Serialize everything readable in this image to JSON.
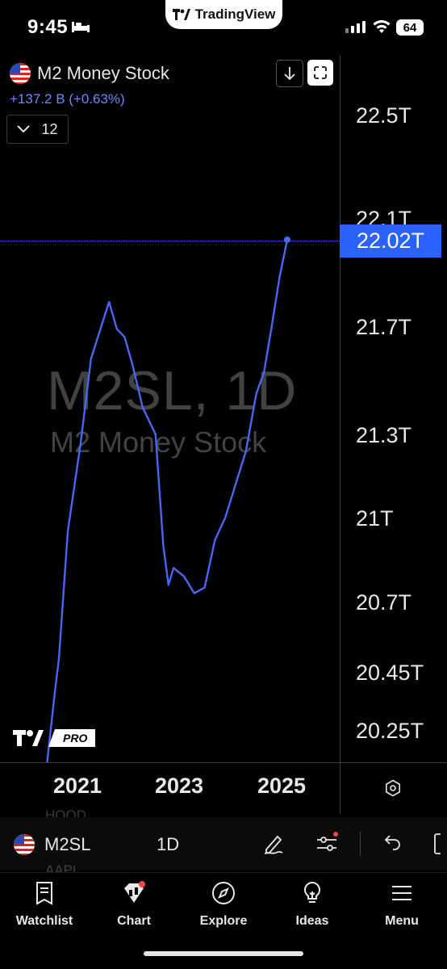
{
  "status_bar": {
    "time": "9:45",
    "app_pill": "TradingView",
    "battery": "64"
  },
  "header": {
    "title": "M2 Money Stock",
    "change": "+137.2 B (+0.63%)",
    "interval_count": "12"
  },
  "watermark": {
    "line1": "M2SL, 1D",
    "line2": "M2 Money Stock"
  },
  "price_axis": {
    "labels": [
      "22.5T",
      "22.1T",
      "21.7T",
      "21.3T",
      "21T",
      "20.7T",
      "20.45T",
      "20.25T"
    ],
    "current": "22.02T"
  },
  "time_axis": {
    "labels": [
      "2021",
      "2023",
      "2025"
    ]
  },
  "logo": {
    "badge": "PRO"
  },
  "ghost_watchlist": [
    "HOOD",
    "AAPL"
  ],
  "ticker_row": {
    "symbol": "M2SL",
    "interval": "1D"
  },
  "nav": [
    {
      "label": "Watchlist",
      "icon": "watchlist-icon"
    },
    {
      "label": "Chart",
      "icon": "chart-icon"
    },
    {
      "label": "Explore",
      "icon": "compass-icon"
    },
    {
      "label": "Ideas",
      "icon": "lightbulb-icon"
    },
    {
      "label": "Menu",
      "icon": "hamburger-icon"
    }
  ],
  "colors": {
    "accent": "#2962ff",
    "line": "#4a66f5",
    "background": "#000000"
  },
  "chart_data": {
    "type": "line",
    "title": "M2 Money Stock",
    "series": [
      {
        "name": "M2SL",
        "points": [
          [
            2020.35,
            19.0
          ],
          [
            2020.5,
            20.38
          ],
          [
            2020.58,
            20.5
          ],
          [
            2020.75,
            20.95
          ],
          [
            2021.0,
            21.27
          ],
          [
            2021.2,
            21.58
          ],
          [
            2021.45,
            21.73
          ],
          [
            2021.55,
            21.79
          ],
          [
            2021.7,
            21.69
          ],
          [
            2021.85,
            21.66
          ],
          [
            2022.0,
            21.56
          ],
          [
            2022.2,
            21.4
          ],
          [
            2022.45,
            21.3
          ],
          [
            2022.6,
            20.9
          ],
          [
            2022.7,
            20.76
          ],
          [
            2022.8,
            20.82
          ],
          [
            2023.0,
            20.79
          ],
          [
            2023.2,
            20.73
          ],
          [
            2023.4,
            20.75
          ],
          [
            2023.6,
            20.92
          ],
          [
            2023.8,
            21.0
          ],
          [
            2024.0,
            21.12
          ],
          [
            2024.2,
            21.24
          ],
          [
            2024.4,
            21.45
          ],
          [
            2024.55,
            21.53
          ],
          [
            2024.7,
            21.7
          ],
          [
            2024.85,
            21.88
          ],
          [
            2025.0,
            22.02
          ]
        ]
      }
    ],
    "ylabel": "",
    "xlabel": "",
    "last_value": 22.02,
    "yticks": [
      22.5,
      22.1,
      21.7,
      21.3,
      21.0,
      20.7,
      20.45,
      20.25
    ],
    "xticks": [
      2021,
      2023,
      2025
    ],
    "grid": false
  }
}
